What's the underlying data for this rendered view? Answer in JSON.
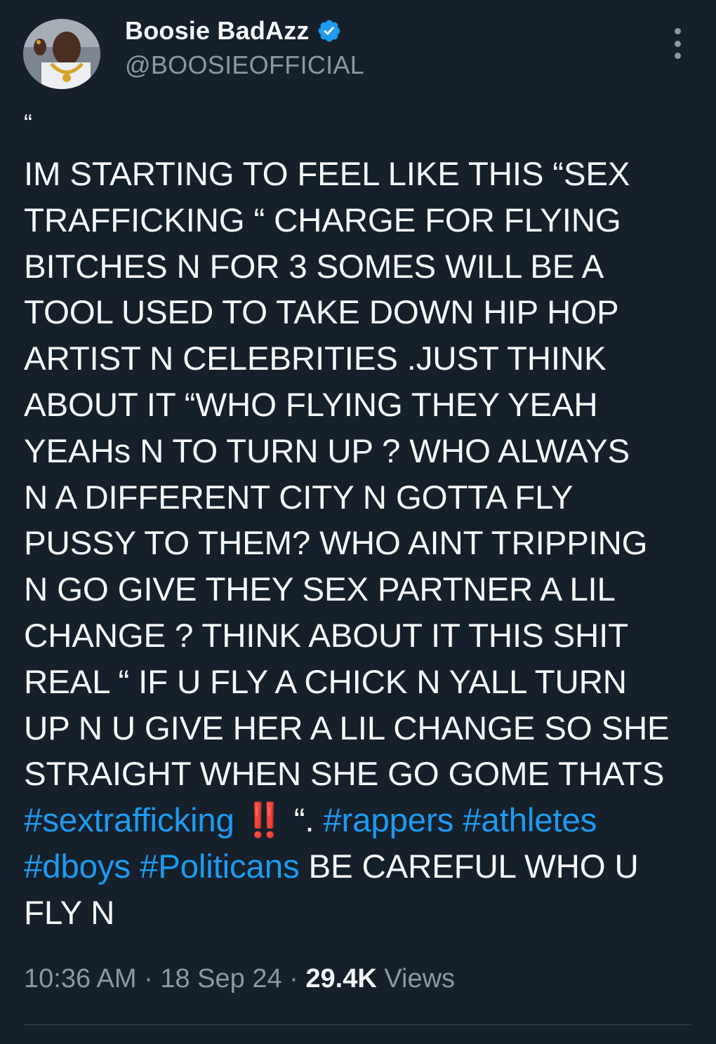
{
  "author": {
    "display_name": "Boosie BadAzz",
    "handle": "@BOOSIEOFFICIAL",
    "verified": true
  },
  "tweet": {
    "quote_mark": "“",
    "lines": [
      [
        "IM STARTING TO FEEL LIKE THIS “SEX"
      ],
      [
        "TRAFFICKING “ CHARGE FOR FLYING"
      ],
      [
        "BITCHES N FOR 3 SOMES WILL BE A"
      ],
      [
        "TOOL USED TO TAKE DOWN HIP HOP"
      ],
      [
        "ARTIST N CELEBRITIES .JUST THINK"
      ],
      [
        "ABOUT IT “WHO FLYING THEY YEAH"
      ],
      [
        "YEAHs N TO TURN UP ? WHO ALWAYS"
      ],
      [
        "N A DIFFERENT CITY N GOTTA FLY"
      ],
      [
        "PUSSY TO THEM? WHO AINT TRIPPING"
      ],
      [
        "N GO GIVE THEY SEX PARTNER A LIL"
      ],
      [
        "CHANGE ? THINK ABOUT IT THIS SHIT"
      ],
      [
        "REAL “ IF U FLY A CHICK N YALL TURN"
      ],
      [
        "UP N U GIVE HER A LIL CHANGE SO SHE"
      ],
      [
        "STRAIGHT WHEN SHE GO GOME THATS"
      ]
    ],
    "line15": {
      "hashtag1": "#sextrafficking",
      "emoji": "‼️",
      "text_after_emoji": " “. ",
      "hashtag2": "#rappers",
      "hashtag3": "#athletes"
    },
    "line16": {
      "hashtag4": "#dboys",
      "hashtag5": "#Politicans",
      "text_after": " BE CAREFUL WHO U"
    },
    "line17": "FLY N"
  },
  "meta": {
    "time": "10:36 AM",
    "separator": " · ",
    "date": "18 Sep 24",
    "views_count": "29.4K",
    "views_label": " Views"
  },
  "colors": {
    "background": "#15202b",
    "text": "#f7f9f9",
    "secondary": "#8b98a5",
    "link": "#1d9bf0",
    "verified": "#1d9bf0",
    "emoji": "#e0262f"
  }
}
